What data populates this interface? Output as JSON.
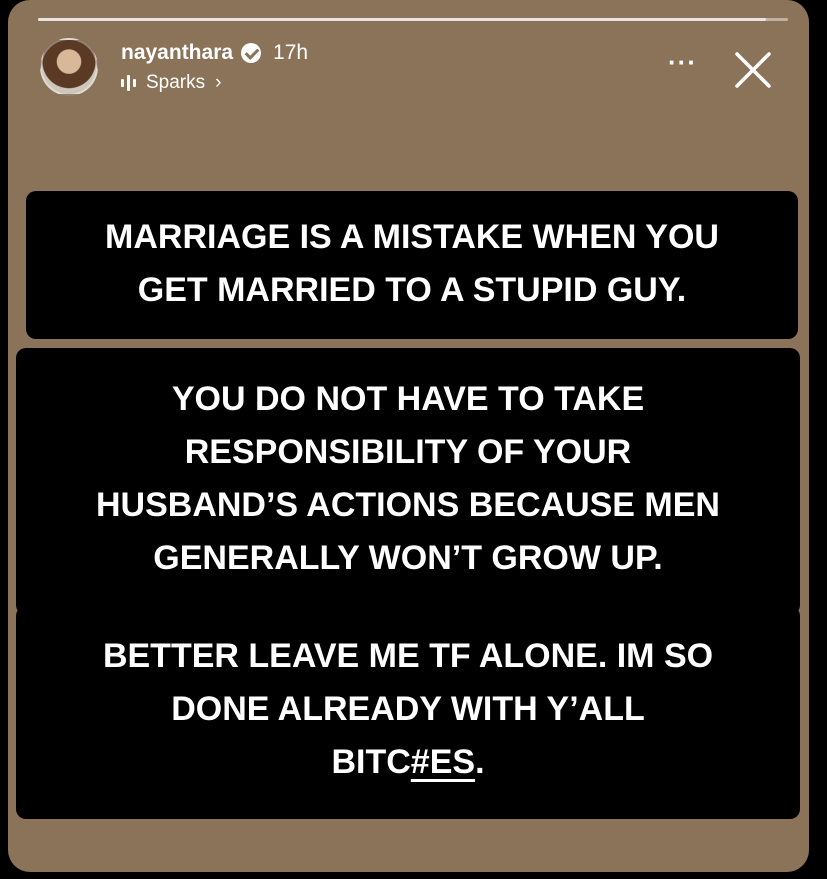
{
  "story": {
    "progress": 0.97,
    "background_color": "#8b7359",
    "header": {
      "username": "nayanthara",
      "time_ago": "17h",
      "music_label": "Sparks",
      "music_chevron": "›",
      "avatar_icon": "profile-photo",
      "verified_icon": "verified-badge-icon",
      "more_icon": "more-options-icon",
      "close_icon": "close-icon",
      "more_glyph": "···"
    },
    "text_blocks": [
      {
        "lines": [
          "MARRIAGE IS A MISTAKE WHEN YOU",
          "GET MARRIED TO A STUPID GUY."
        ]
      },
      {
        "lines": [
          "YOU DO NOT HAVE TO TAKE",
          "RESPONSIBILITY OF YOUR",
          "HUSBAND’S ACTIONS BECAUSE MEN",
          "GENERALLY WON’T GROW UP."
        ]
      },
      {
        "lines": [
          "BETTER LEAVE ME TF ALONE. IM SO",
          "DONE ALREADY WITH Y’ALL"
        ],
        "last_line_plain": "BITC",
        "last_line_underlined": "#ES",
        "last_line_end": "."
      }
    ]
  }
}
